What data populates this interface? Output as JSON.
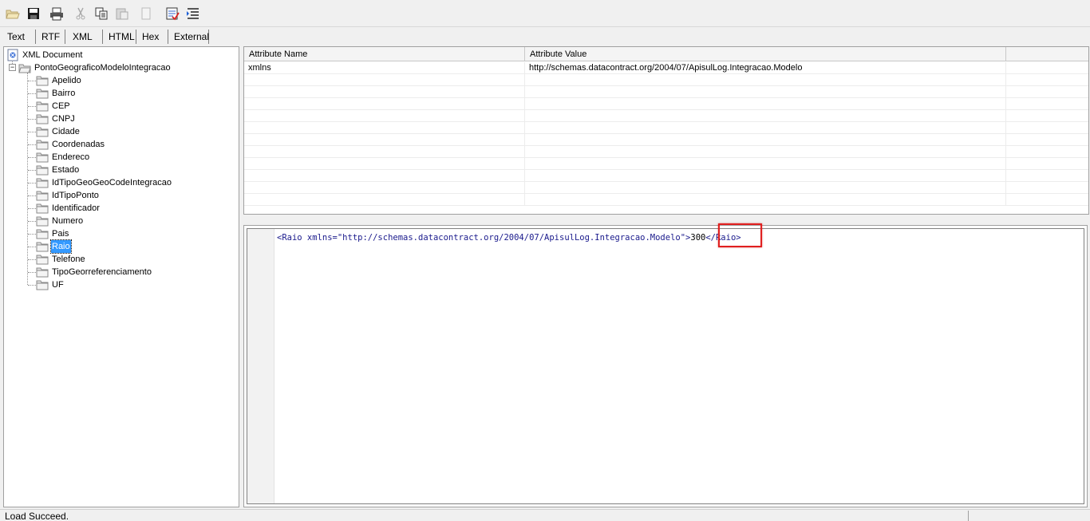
{
  "toolbar": {
    "buttons": [
      {
        "name": "open-icon"
      },
      {
        "name": "save-icon"
      },
      {
        "name": "print-icon"
      },
      {
        "name": "cut-icon"
      },
      {
        "name": "copy-icon"
      },
      {
        "name": "paste-icon"
      },
      {
        "name": "blank-page-icon"
      },
      {
        "name": "validate-icon"
      },
      {
        "name": "indent-icon"
      }
    ]
  },
  "tabs": [
    "Text",
    "RTF",
    "XML",
    "HTML",
    "Hex",
    "External"
  ],
  "active_tab": "XML",
  "tree": {
    "root": "XML Document",
    "element": "PontoGeograficoModeloIntegracao",
    "children": [
      "Apelido",
      "Bairro",
      "CEP",
      "CNPJ",
      "Cidade",
      "Coordenadas",
      "Endereco",
      "Estado",
      "IdTipoGeoGeoCodeIntegracao",
      "IdTipoPonto",
      "Identificador",
      "Numero",
      "Pais",
      "Raio",
      "Telefone",
      "TipoGeorreferenciamento",
      "UF"
    ],
    "selected": "Raio"
  },
  "attributes": {
    "headers": [
      "Attribute Name",
      "Attribute Value"
    ],
    "rows": [
      {
        "name": "xmlns",
        "value": "http://schemas.datacontract.org/2004/07/ApisulLog.Integracao.Modelo"
      }
    ]
  },
  "source": {
    "open_tag": "<Raio xmlns=\"http://schemas.datacontract.org/2004/07/ApisulLog.Integracao.Modelo\">",
    "text": "300",
    "close_tag": "</Raio>"
  },
  "status": {
    "text": "Load Succeed."
  },
  "colors": {
    "highlight": "#e02020",
    "selection": "#3399ff",
    "xml_markup": "#1a1a8c"
  }
}
